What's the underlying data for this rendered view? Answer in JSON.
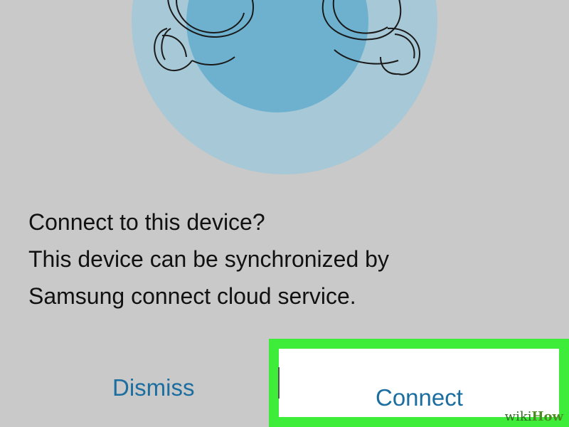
{
  "illustration": {
    "icon": "earbuds-icon",
    "outer_circle_color": "#a7c8d6",
    "inner_circle_color": "#6db1cf"
  },
  "dialog": {
    "title": "Connect to this device?",
    "body_line1": "This device can be synchronized by",
    "body_line2": "Samsung connect cloud service."
  },
  "buttons": {
    "dismiss_label": "Dismiss",
    "connect_label": "Connect"
  },
  "colors": {
    "background": "#c9c9c9",
    "button_text": "#1c6ea0",
    "highlight": "#3ded3a"
  },
  "watermark": {
    "part1": "wiki",
    "part2": "How"
  }
}
